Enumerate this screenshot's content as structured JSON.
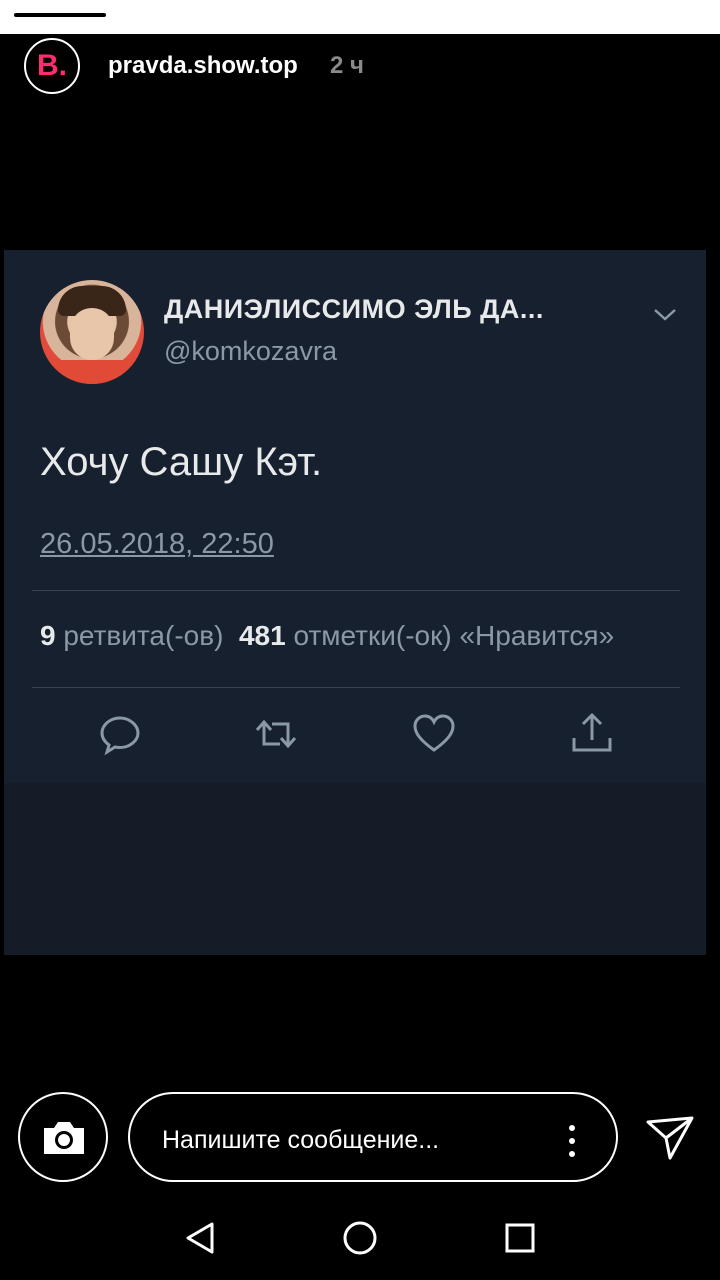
{
  "story": {
    "account": "pravda.show.top",
    "time": "2 ч",
    "logo_letter": "B."
  },
  "tweet": {
    "display_name": "ДАНИЭЛИССИМО ЭЛЬ ДА...",
    "handle": "@komkozavra",
    "text": "Хочу Сашу Кэт.",
    "date": "26.05.2018, 22:50",
    "retweets_count": "9",
    "retweets_label": "ретвита(-ов)",
    "likes_count": "481",
    "likes_label": "отметки(-ок) «Нравится»"
  },
  "reply": {
    "placeholder": "Напишите сообщение..."
  },
  "colors": {
    "card_bg": "#17202e",
    "logo_accent": "#ff2d6f",
    "muted": "#8b98a5"
  },
  "icons": [
    "camera-icon",
    "more-vertical-icon",
    "send-icon",
    "back-icon",
    "home-icon",
    "recents-icon",
    "reply-icon",
    "retweet-icon",
    "like-icon",
    "share-icon",
    "chevron-down-icon"
  ]
}
